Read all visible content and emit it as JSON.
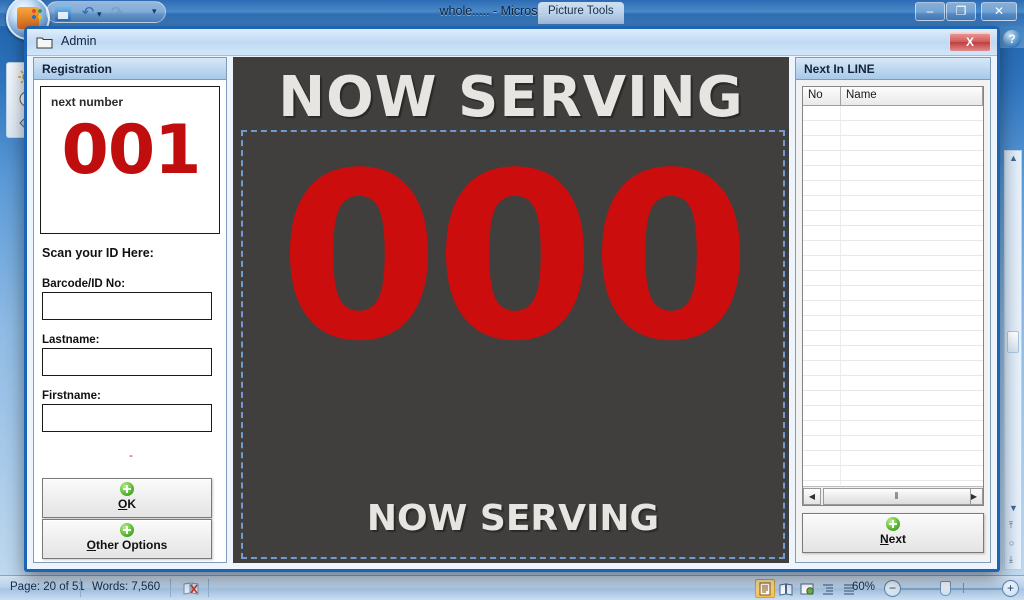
{
  "word": {
    "title": "whole..... - Microsoft Word",
    "picture_tools_tab": "Picture Tools",
    "orb_name": "office-button",
    "quick_access": {
      "save": "save-icon",
      "undo": "↶",
      "redo": "↷",
      "dropdown": "▾",
      "customize": "▾"
    },
    "window_buttons": {
      "minimize": "–",
      "maximize": "❐",
      "close": "✕"
    },
    "help_button": "?",
    "status_bar": {
      "page": "Page: 20 of 51",
      "words": "Words: 7,560",
      "proofing_icon": "proofing-errors-icon",
      "zoom": "60%",
      "zoom_out": "−",
      "zoom_in": "+",
      "views": [
        {
          "name": "print-layout",
          "glyph": "▤",
          "active": true
        },
        {
          "name": "full-screen-reading",
          "glyph": "▭",
          "active": false
        },
        {
          "name": "web-layout",
          "glyph": "▧",
          "active": false
        },
        {
          "name": "outline",
          "glyph": "≣",
          "active": false
        },
        {
          "name": "draft",
          "glyph": "☰",
          "active": false
        }
      ]
    },
    "scroll": {
      "up_arrow": "▲",
      "down_arrow": "▼",
      "prev_page": "⤒",
      "select_object": "○",
      "next_page": "⤓"
    }
  },
  "admin": {
    "title": "Admin",
    "icon": "folder-icon",
    "close_label": "X",
    "registration": {
      "header": "Registration",
      "next_number_label": "next number",
      "next_number_value": "001",
      "scan_label": "Scan your ID Here:",
      "fields": [
        {
          "label": "Barcode/ID  No:",
          "value": "",
          "placeholder": ""
        },
        {
          "label": "Lastname:",
          "value": "",
          "placeholder": ""
        },
        {
          "label": "Firstname:",
          "value": "",
          "placeholder": ""
        }
      ],
      "separator_mark": "-",
      "buttons": [
        {
          "label_pre": "",
          "accel": "O",
          "label_post": "K",
          "icon": "green-plus-icon"
        },
        {
          "label_pre": "",
          "accel": "O",
          "label_post": "ther Options",
          "icon": "green-plus-icon"
        }
      ]
    },
    "display": {
      "title": "NOW SERVING",
      "number": "000",
      "footer": "NOW SERVING",
      "background_color": "#403f3d",
      "number_color": "#cc0d0d",
      "text_color": "#e6e5e1",
      "dashed_border_color": "#6f9bd0"
    },
    "next_in_line": {
      "header": "Next In LINE",
      "columns": [
        "No",
        "Name"
      ],
      "rows": [],
      "empty_row_count": 26,
      "hscroll": {
        "left_arrow": "◀",
        "right_arrow": "▶",
        "thumb_grip": "⫴"
      },
      "next_button": {
        "label_pre": "",
        "accel": "N",
        "label_post": "ext",
        "icon": "green-plus-icon"
      }
    }
  }
}
